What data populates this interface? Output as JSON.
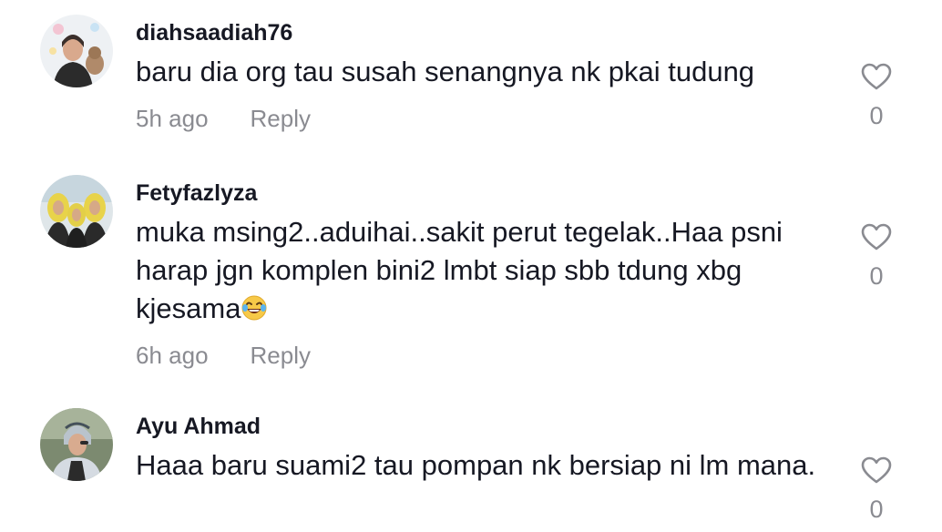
{
  "comments": [
    {
      "username": "diahsaadiah76",
      "text": "baru dia org tau susah senangnya nk pkai tudung",
      "time": "5h ago",
      "reply_label": "Reply",
      "likes": "0",
      "icon": "heart-outline-icon"
    },
    {
      "username": "Fetyfazlyza",
      "text": "muka msing2..aduihai..sakit perut tegelak..Haa psni harap jgn komplen bini2 lmbt siap sbb tdung xbg kjesama",
      "emoji": "😂",
      "time": "6h ago",
      "reply_label": "Reply",
      "likes": "0",
      "icon": "heart-outline-icon"
    },
    {
      "username": "Ayu Ahmad",
      "text": "Haaa baru suami2 tau pompan nk bersiap ni lm mana.",
      "time": "",
      "reply_label": "",
      "likes": "0",
      "icon": "heart-outline-icon"
    }
  ],
  "colors": {
    "text": "#161823",
    "secondary": "#8a8b91"
  }
}
